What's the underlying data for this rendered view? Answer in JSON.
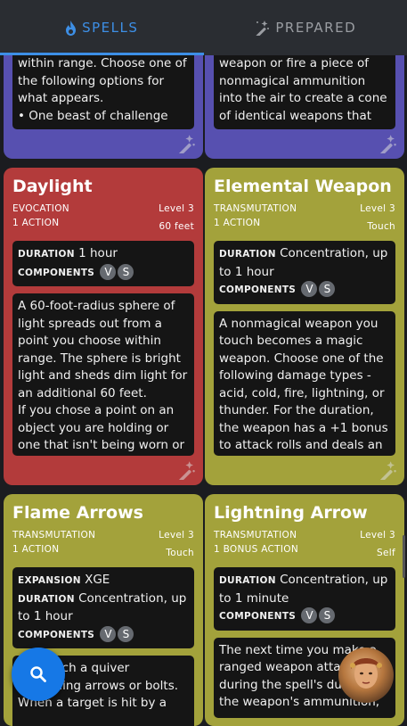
{
  "tabs": [
    {
      "label": "SPELLS",
      "icon": "flame-icon",
      "active": true
    },
    {
      "label": "PREPARED",
      "icon": "magic-wand-icon",
      "active": false
    }
  ],
  "colors": {
    "accent": "#3d8fe6",
    "conjuration": "#5750b0",
    "evocation": "#b33b3b",
    "transmutation": "#a3a23b"
  },
  "cards": {
    "top_left": {
      "desc": "within range. Choose one of the following options for what appears.\n• One beast of challenge"
    },
    "top_right": {
      "desc": "weapon or fire a piece of nonmagical ammunition into the air to create a cone of identical weapons that"
    },
    "daylight": {
      "name": "Daylight",
      "school": "EVOCATION",
      "level": "Level 3",
      "cast_time": "1 ACTION",
      "range": "60 feet",
      "duration_label": "DURATION",
      "duration": "1 hour",
      "components_label": "COMPONENTS",
      "components": [
        "V",
        "S"
      ],
      "desc": "A 60-foot-radius sphere of light spreads out from a point you choose within range. The sphere is bright light and sheds dim light for an additional 60 feet.\nIf you chose a point on an object you are holding or one that isn't being worn or"
    },
    "elemental_weapon": {
      "name": "Elemental Weapon",
      "school": "TRANSMUTATION",
      "level": "Level 3",
      "cast_time": "1 ACTION",
      "range": "Touch",
      "duration_label": "DURATION",
      "duration": "Concentration, up to 1 hour",
      "components_label": "COMPONENTS",
      "components": [
        "V",
        "S"
      ],
      "desc": "A nonmagical weapon you touch becomes a magic weapon. Choose one of the following damage types - acid, cold, fire, lightning, or thunder. For the duration, the weapon has a +1 bonus to attack rolls and deals an"
    },
    "flame_arrows": {
      "name": "Flame Arrows",
      "school": "TRANSMUTATION",
      "level": "Level 3",
      "cast_time": "1 ACTION",
      "range": "Touch",
      "expansion_label": "EXPANSION",
      "expansion": "XGE",
      "duration_label": "DURATION",
      "duration": "Concentration, up to 1 hour",
      "components_label": "COMPONENTS",
      "components": [
        "V",
        "S"
      ],
      "desc": "You touch a quiver containing arrows or bolts. When a target is hit by a"
    },
    "lightning_arrow": {
      "name": "Lightning Arrow",
      "school": "TRANSMUTATION",
      "level": "Level 3",
      "cast_time": "1 BONUS ACTION",
      "range": "Self",
      "duration_label": "DURATION",
      "duration": "Concentration, up to 1 minute",
      "components_label": "COMPONENTS",
      "components": [
        "V",
        "S"
      ],
      "desc": "The next time you make a ranged weapon attack during the spell's duration, the weapon's ammunition,"
    }
  },
  "fab": {
    "icon": "search-icon"
  },
  "avatar": {
    "icon": "character-avatar-icon"
  }
}
